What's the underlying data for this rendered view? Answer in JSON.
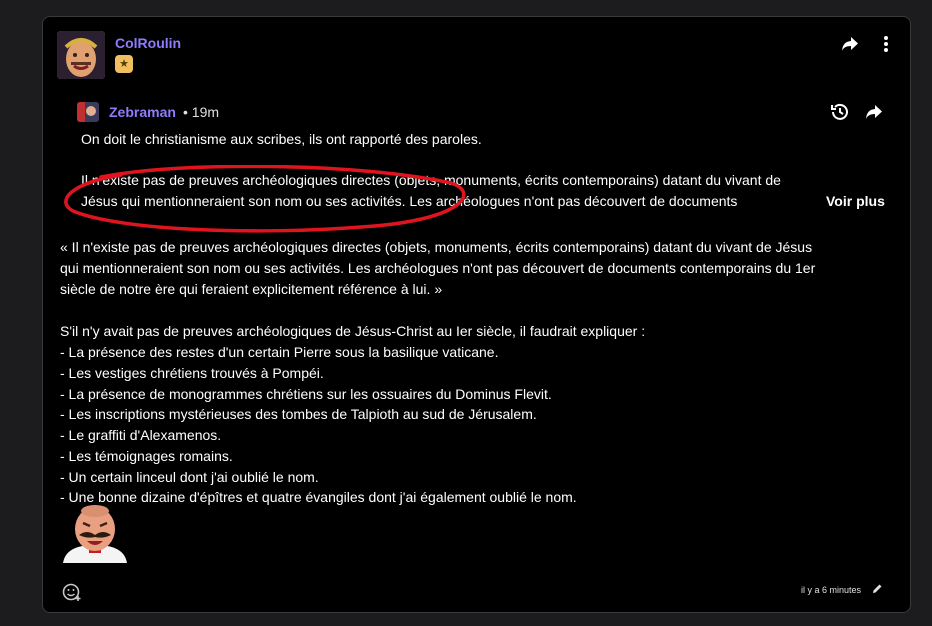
{
  "post": {
    "author": "ColRoulin",
    "badge_icon": "star-badge",
    "badge_glyph": "★",
    "accent_color": "#8e7cff"
  },
  "quote": {
    "author": "Zebraman",
    "time": "• 19m",
    "lines": [
      "On doit le christianisme aux scribes, ils ont rapporté des paroles.",
      "Il n'existe pas de preuves archéologiques directes (objets, monuments, écrits contemporains) datant du vivant de",
      "Jésus qui mentionneraient son nom ou ses activités. Les archéologues n'ont pas découvert de documents"
    ],
    "more_label": "Voir plus"
  },
  "body": {
    "lines": [
      "« Il n'existe pas de preuves archéologiques directes (objets, monuments, écrits contemporains) datant du vivant de Jésus",
      "qui mentionneraient son nom ou ses activités. Les archéologues n'ont pas découvert de documents contemporains du 1er",
      "siècle de notre ère qui feraient explicitement référence à lui. »",
      "S'il n'y avait pas de preuves archéologiques de Jésus-Christ au Ier siècle, il faudrait expliquer :",
      "- La présence des restes d'un certain Pierre sous la basilique vaticane.",
      "- Les vestiges chrétiens trouvés à Pompéi.",
      "- La présence de monogrammes chrétiens sur les ossuaires du Dominus Flevit.",
      "- Les inscriptions mystérieuses des tombes de Talpioth au sud de Jérusalem.",
      "- Le graffiti d'Alexamenos.",
      "- Les témoignages romains.",
      "- Un certain linceul dont j'ai oublié le nom.",
      "- Une bonne dizaine d'épîtres et quatre évangiles dont j'ai également oublié le nom."
    ]
  },
  "footer": {
    "timestamp": "il y a 6 minutes"
  }
}
